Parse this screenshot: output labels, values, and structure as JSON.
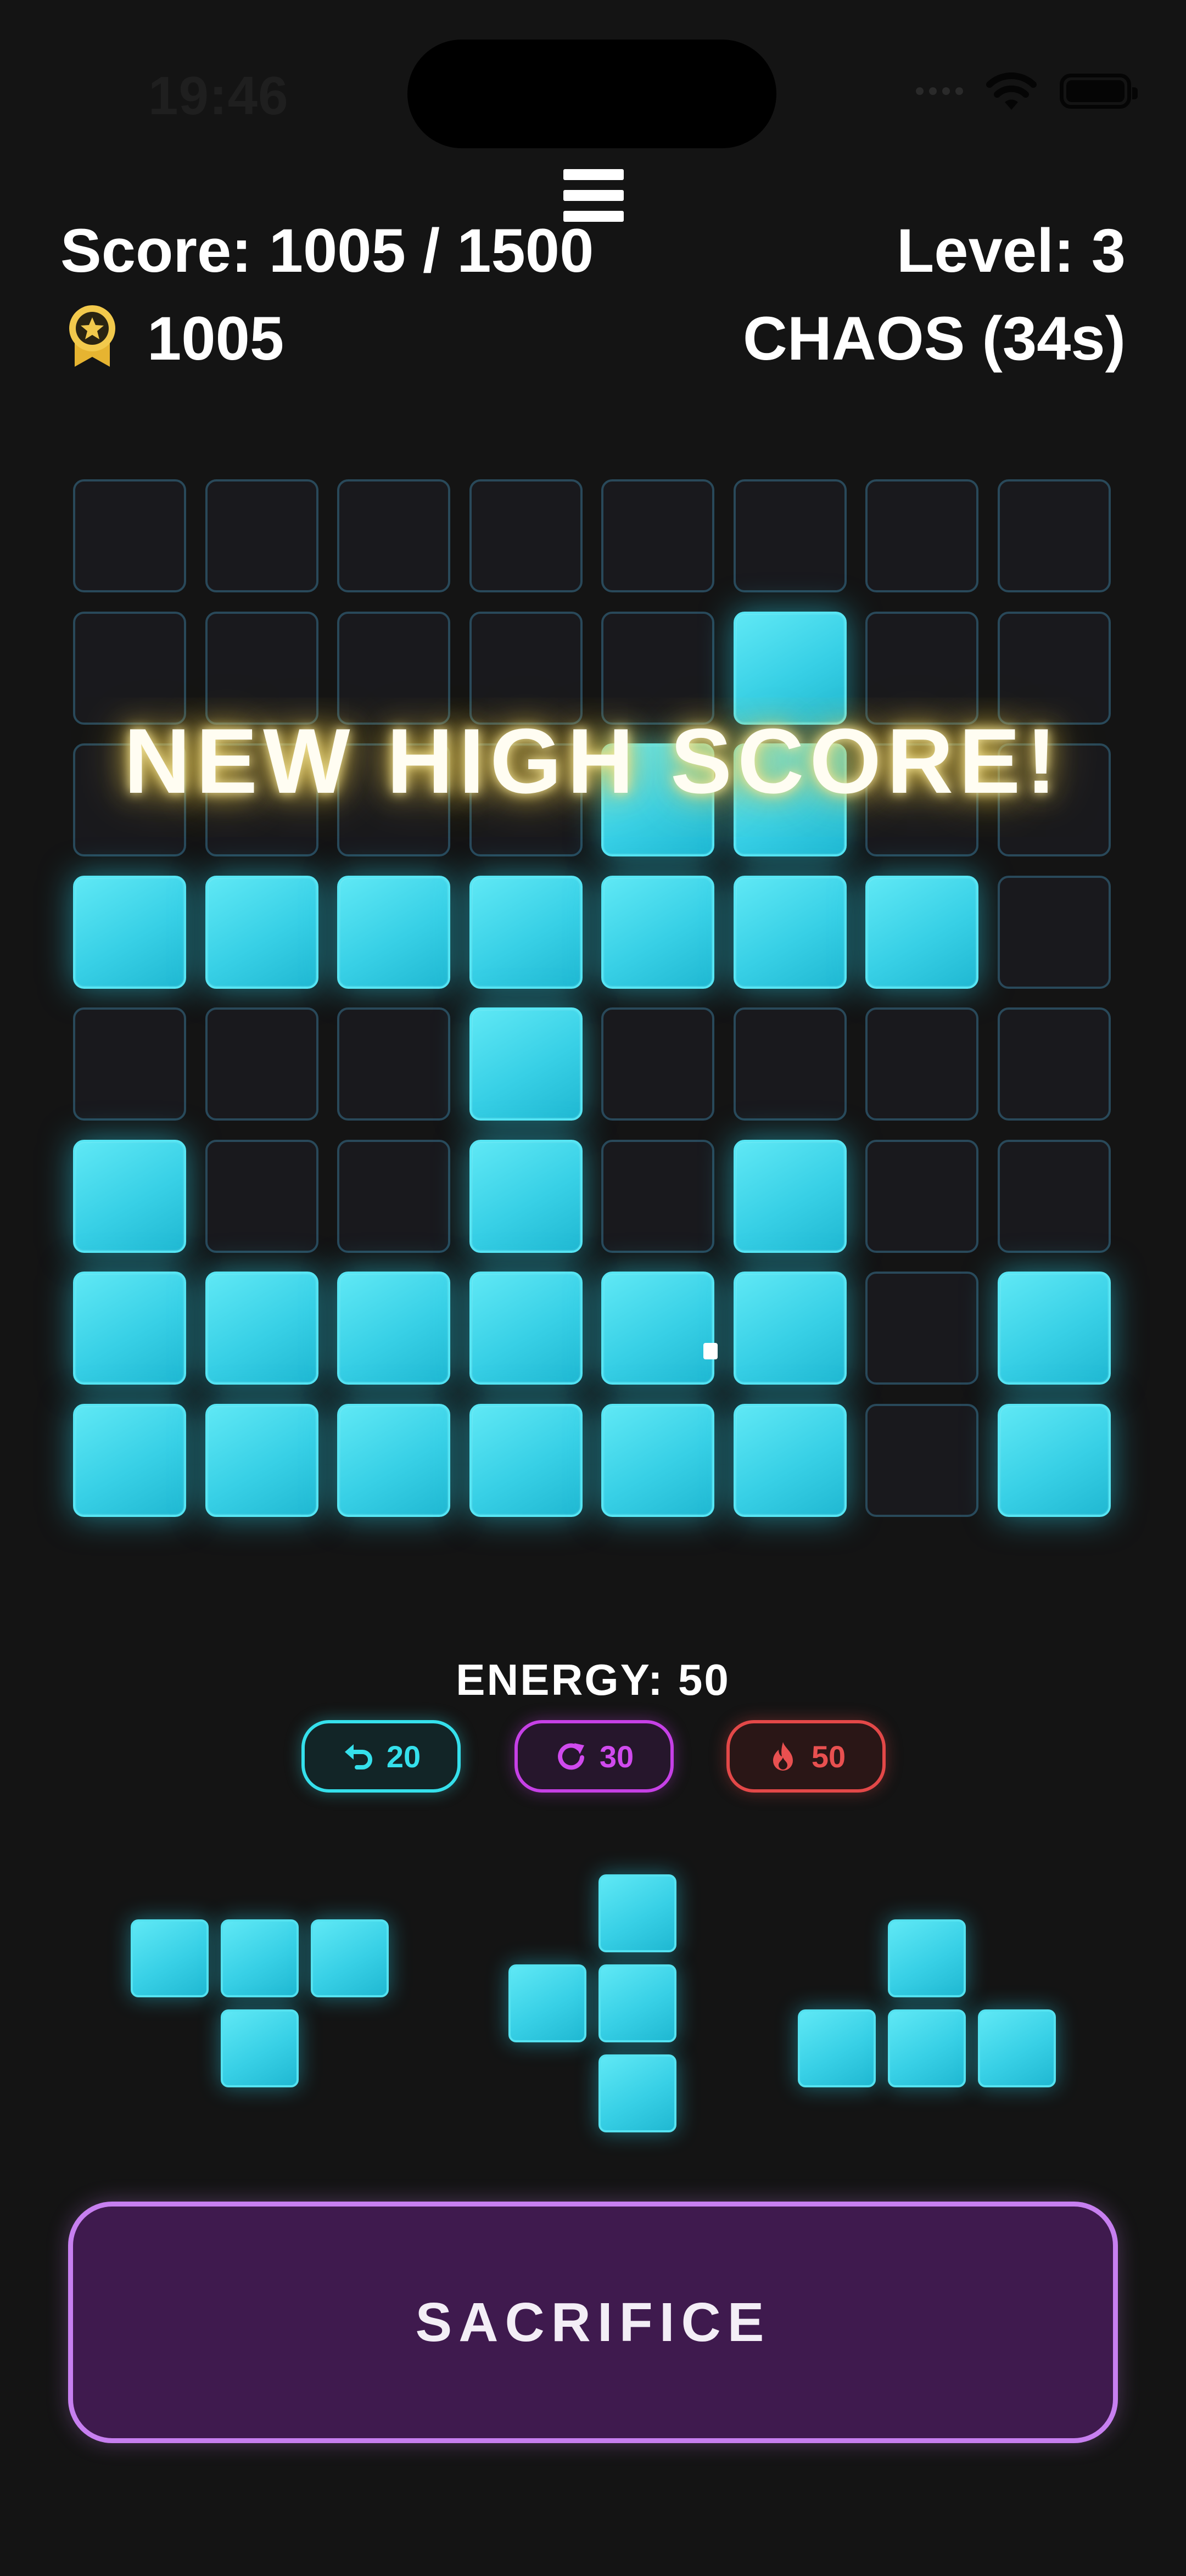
{
  "status_bar": {
    "time": "19:46",
    "icons": [
      "signal-icon",
      "wifi-icon",
      "battery-icon"
    ]
  },
  "header": {
    "menu_icon": "hamburger-menu-icon",
    "score": "Score: 1005 / 1500",
    "level": "Level: 3",
    "best_icon": "award-ribbon-icon",
    "best_score": "1005",
    "mode": "CHAOS (34s)"
  },
  "board": {
    "size": 8,
    "rows": [
      [
        0,
        0,
        0,
        0,
        0,
        0,
        0,
        0
      ],
      [
        0,
        0,
        0,
        0,
        0,
        1,
        0,
        0
      ],
      [
        0,
        0,
        0,
        0,
        1,
        1,
        0,
        0
      ],
      [
        1,
        1,
        1,
        1,
        1,
        1,
        1,
        0
      ],
      [
        0,
        0,
        0,
        1,
        0,
        0,
        0,
        0
      ],
      [
        1,
        0,
        0,
        1,
        0,
        1,
        0,
        0
      ],
      [
        1,
        1,
        1,
        1,
        1,
        1,
        0,
        1
      ],
      [
        1,
        1,
        1,
        1,
        1,
        1,
        0,
        1
      ]
    ],
    "filled_color": "#38d0e6",
    "empty_border_color": "#29495a",
    "overlay_text": "NEW HIGH SCORE!"
  },
  "energy": {
    "label": "ENERGY: 50",
    "powerups": [
      {
        "icon": "undo-icon",
        "cost": "20",
        "color": "#35e0ec"
      },
      {
        "icon": "rotate-icon",
        "cost": "30",
        "color": "#d04aee"
      },
      {
        "icon": "fire-icon",
        "cost": "50",
        "color": "#e85050"
      }
    ]
  },
  "tray": {
    "pieces": [
      {
        "name": "t-down-piece",
        "cells": [
          [
            0,
            0
          ],
          [
            0,
            1
          ],
          [
            0,
            2
          ],
          [
            1,
            1
          ]
        ]
      },
      {
        "name": "t-left-piece",
        "cells": [
          [
            0,
            1
          ],
          [
            1,
            0
          ],
          [
            1,
            1
          ],
          [
            2,
            1
          ]
        ]
      },
      {
        "name": "t-up-piece",
        "cells": [
          [
            0,
            1
          ],
          [
            1,
            0
          ],
          [
            1,
            1
          ],
          [
            1,
            2
          ]
        ]
      }
    ]
  },
  "actions": {
    "sacrifice_label": "SACRIFICE"
  },
  "colors": {
    "background": "#141414",
    "accent_cyan": "#38d0e6",
    "accent_purple": "#c77ff0",
    "gold": "#f2c94c"
  }
}
